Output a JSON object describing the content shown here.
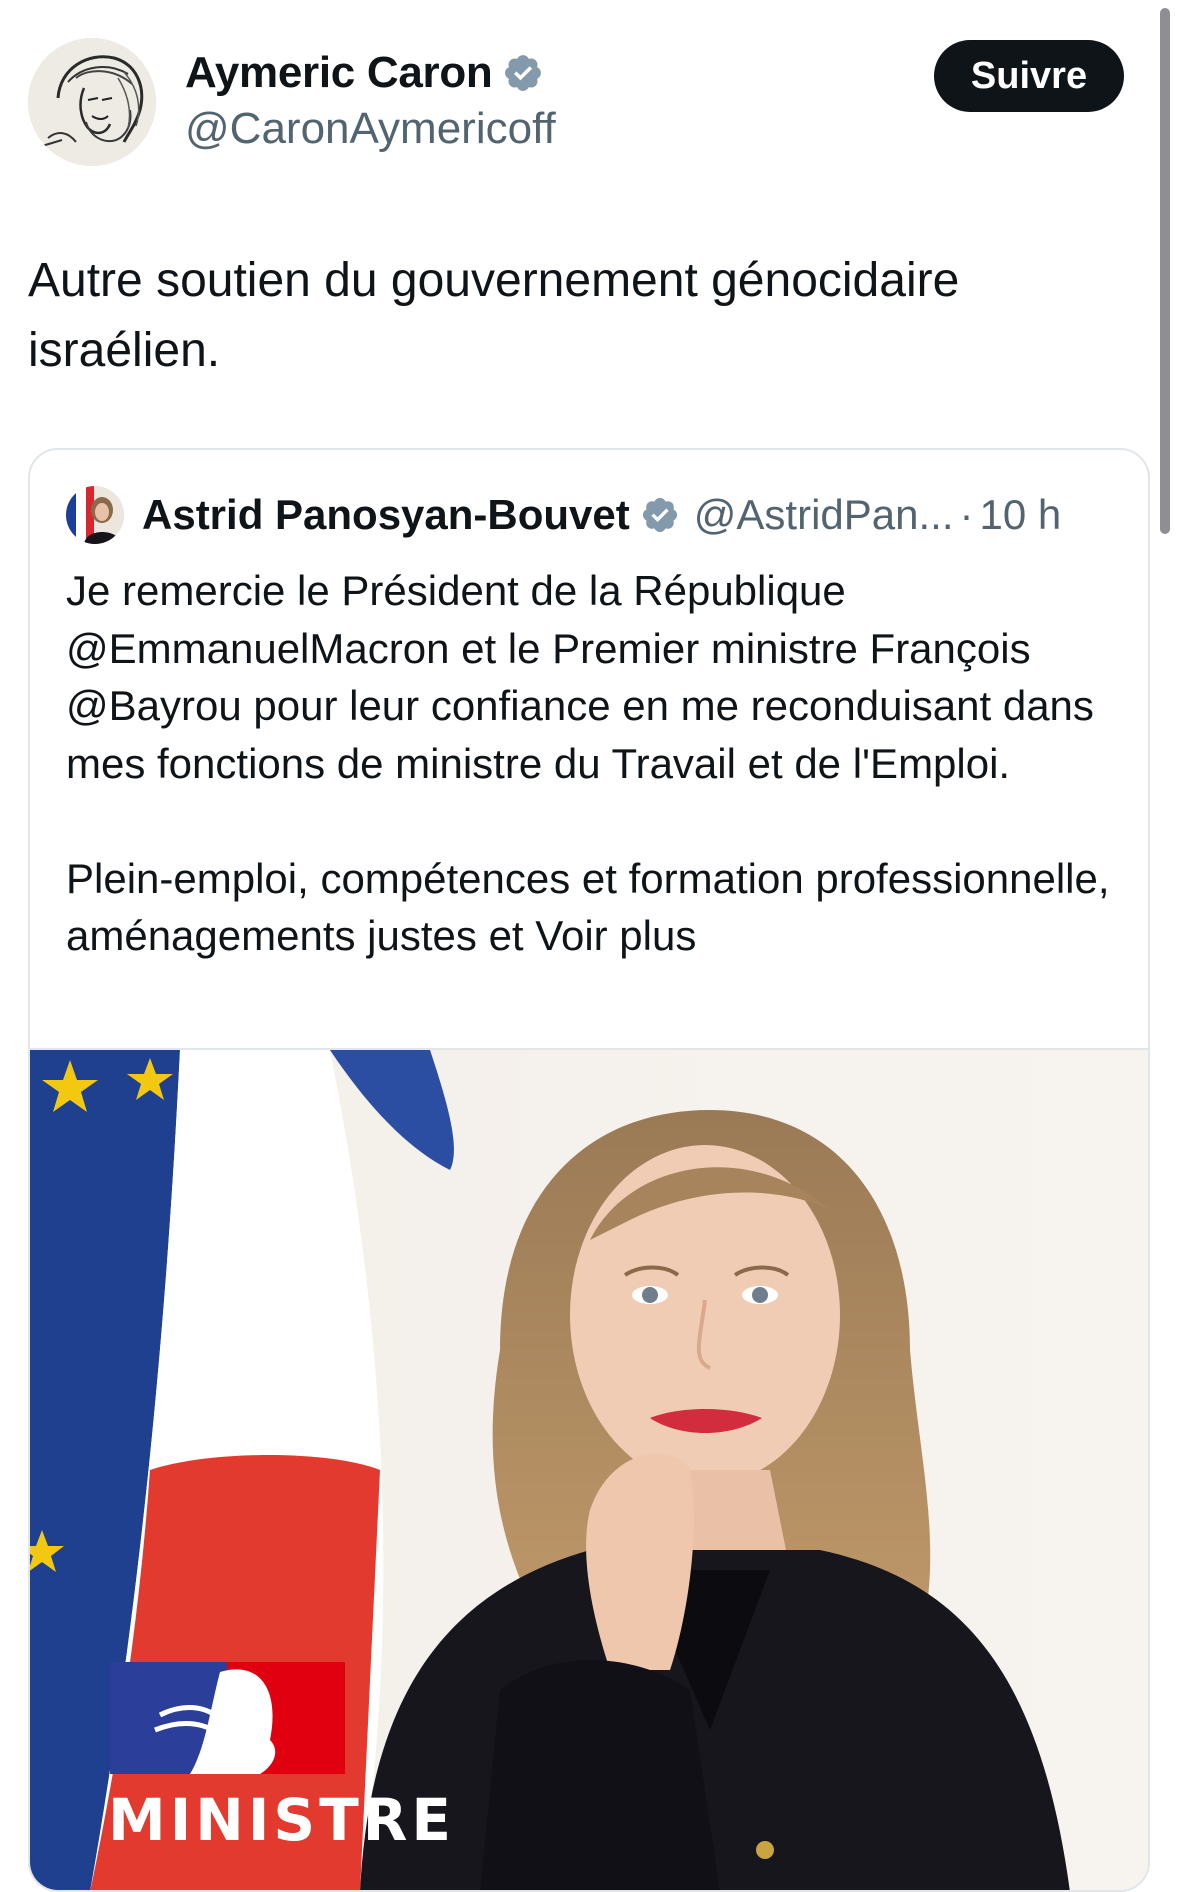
{
  "author": {
    "name": "Aymeric Caron",
    "handle": "@CaronAymericoff",
    "verified": true
  },
  "follow_button": {
    "label": "Suivre"
  },
  "tweet": {
    "text": "Autre soutien du gouvernement génocidaire israélien."
  },
  "quoted_tweet": {
    "author_name": "Astrid Panosyan-Bouvet",
    "handle": "@AstridPan...",
    "separator": "·",
    "time": "10 h",
    "verified": true,
    "paragraph_1": "Je remercie le Président de la République @EmmanuelMacron et le Premier ministre François @Bayrou pour leur confiance en me reconduisant dans mes fonctions de ministre du Travail et de l'Emploi.",
    "paragraph_2": "Plein-emploi, compétences et formation professionnelle, aménagements justes et",
    "more_label": "Voir plus",
    "media": {
      "logo_text": "MINISTRE"
    }
  },
  "colors": {
    "text": "#0f1419",
    "secondary": "#536471",
    "verified_badge": "#829aab",
    "border": "#e1e6ea",
    "follow_bg": "#0f1419"
  },
  "icons": {
    "verified": "verified-badge-icon"
  }
}
